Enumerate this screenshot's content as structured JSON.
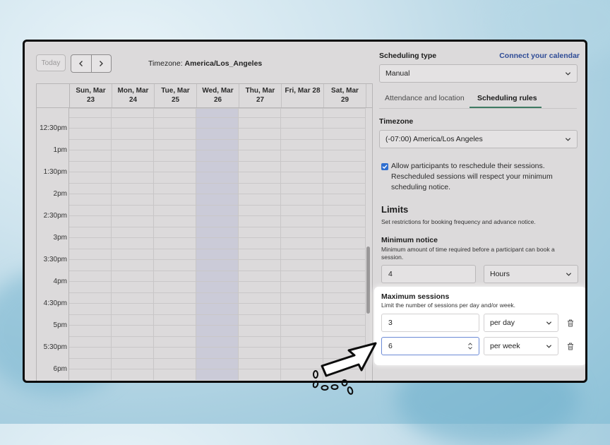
{
  "toolbar": {
    "today_label": "Today",
    "timezone_prefix": "Timezone: ",
    "timezone_value": "America/Los_Angeles"
  },
  "calendar": {
    "days": [
      {
        "l1": "Sun, Mar",
        "l2": "23"
      },
      {
        "l1": "Mon, Mar",
        "l2": "24"
      },
      {
        "l1": "Tue, Mar",
        "l2": "25"
      },
      {
        "l1": "Wed, Mar",
        "l2": "26"
      },
      {
        "l1": "Thu, Mar",
        "l2": "27"
      },
      {
        "l1": "Fri, Mar 28",
        "l2": ""
      },
      {
        "l1": "Sat, Mar",
        "l2": "29"
      }
    ],
    "times": [
      "",
      "12:30pm",
      "1pm",
      "1:30pm",
      "2pm",
      "2:30pm",
      "3pm",
      "3:30pm",
      "4pm",
      "4:30pm",
      "5pm",
      "5:30pm",
      "6pm"
    ],
    "highlight_day_index": 3
  },
  "panel": {
    "scheduling_type_label": "Scheduling type",
    "connect_calendar_link": "Connect your calendar",
    "scheduling_type_value": "Manual",
    "tabs": [
      "Attendance and location",
      "Scheduling rules"
    ],
    "active_tab_index": 1,
    "timezone_label": "Timezone",
    "timezone_value": "(-07:00) America/Los Angeles",
    "allow_reschedule_text": "Allow participants to reschedule their sessions. Rescheduled sessions will respect your minimum scheduling notice.",
    "allow_reschedule_checked": true,
    "limits_heading": "Limits",
    "limits_desc": "Set restrictions for booking frequency and advance notice.",
    "min_notice_label": "Minimum notice",
    "min_notice_desc": "Minimum amount of time required before a participant can book a session.",
    "min_notice_value": "4",
    "min_notice_unit": "Hours",
    "max_sessions_label": "Maximum sessions",
    "max_sessions_desc": "Limit the number of sessions per day and/or week.",
    "max_rows": [
      {
        "value": "3",
        "unit": "per day"
      },
      {
        "value": "6",
        "unit": "per week"
      }
    ]
  },
  "colors": {
    "accent_link": "#2e4b96",
    "tab_underline": "#3f7b63",
    "checkbox": "#2f6fd0",
    "today_column": "#cbcbd8"
  },
  "icons": [
    "chevron-left-icon",
    "chevron-right-icon",
    "chevron-down-icon",
    "check-icon",
    "trash-icon",
    "stepper-icon",
    "pointer-arrow-icon"
  ]
}
